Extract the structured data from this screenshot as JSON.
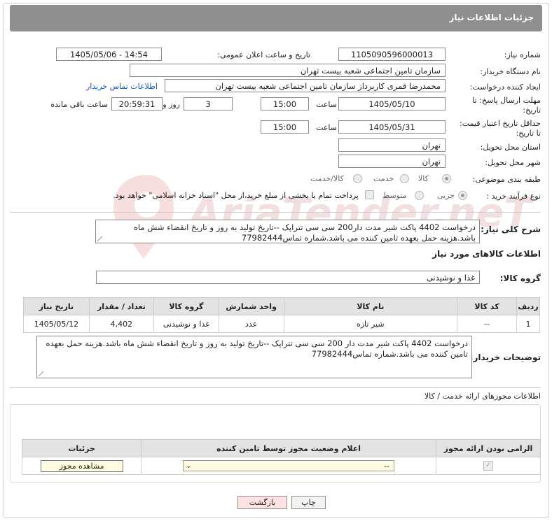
{
  "header": {
    "title": "جزئیات اطلاعات نیاز"
  },
  "form": {
    "need_number_label": "شماره نیاز:",
    "need_number": "1105090596000013",
    "announce_label": "تاریخ و ساعت اعلان عمومی:",
    "announce_value": "1405/05/06 - 14:54",
    "buyer_org_label": "نام دستگاه خریدار:",
    "buyer_org": "سازمان تامین اجتماعی شعبه بیست تهران",
    "requester_label": "ایجاد کننده درخواست:",
    "requester": "محمدرضا قمری کاربرداز  سازمان تامین اجتماعی شعبه بیست تهران",
    "contact_link": "اطلاعات تماس خریدار",
    "deadline_label_1": "مهلت ارسال پاسخ: تا",
    "deadline_label_2": "تاریخ:",
    "deadline_date": "1405/05/10",
    "time_label": "ساعت",
    "deadline_time": "15:00",
    "days_value": "3",
    "days_label": "روز و",
    "remaining_time": "20:59:31",
    "remaining_label": "ساعت باقی مانده",
    "validity_label_1": "حداقل تاریخ اعتبار قیمت:",
    "validity_label_2": "تا تاریخ:",
    "validity_date": "1405/05/31",
    "validity_time": "15:00",
    "province_label": "استان محل تحویل:",
    "province": "تهران",
    "city_label": "شهر محل تحویل:",
    "city": "تهران",
    "category_label": "طبقه بندی موضوعی:",
    "category_options": [
      "کالا",
      "خدمت",
      "کالا/خدمت"
    ],
    "category_selected": "کالا",
    "process_label": "نوع فرآیند خرید :",
    "process_options": [
      "جزیی",
      "متوسط"
    ],
    "process_selected": "جزیی",
    "payment_note": "پرداخت تمام یا بخشی از مبلغ خرید،از محل \"اسناد خزانه اسلامی\" خواهد بود."
  },
  "description": {
    "label": "شرح کلی نیاز:",
    "text": "درخواست 4402 پاکت شیر مدت دار200 سی سی تتراپک --تاریخ تولید به روز و تاریخ انقضاء شش ماه باشد.هزینه حمل بعهده تامین کننده می باشد.شماره تماس77982444"
  },
  "goods": {
    "section_title": "اطلاعات کالاهای مورد نیاز",
    "group_label": "گروه کالا:",
    "group_value": "غذا و نوشیدنی",
    "columns": [
      "ردیف",
      "کد کالا",
      "نام کالا",
      "واحد شمارش",
      "گروه کالا",
      "تعداد / مقدار",
      "تاریخ نیاز"
    ],
    "rows": [
      [
        "1",
        "--",
        "شیر تازه",
        "عدد",
        "غذا و نوشیدنی",
        "4,402",
        "1405/05/12"
      ]
    ]
  },
  "buyer_notes": {
    "label": "توضیحات خریدار:",
    "text": "درخواست 4402 پاکت شیر مدت دار 200 سی سی تتراپک --تاریخ تولید به روز و تاریخ انقضاء شش ماه باشد.هزینه حمل بعهده تامین کننده می باشد.شماره تماس77982444"
  },
  "permits": {
    "section_title": "اطلاعات مجوزهای ارائه خدمت / کالا",
    "columns": [
      "الزامی بودن ارائه مجوز",
      "اعلام وضعیت مجوز توسط تامین کننده",
      "جزئیات"
    ],
    "select_value": "--",
    "view_button": "مشاهده مجوز"
  },
  "actions": {
    "print": "چاپ",
    "back": "بازگشت"
  },
  "watermark": "AriaTender.neT"
}
